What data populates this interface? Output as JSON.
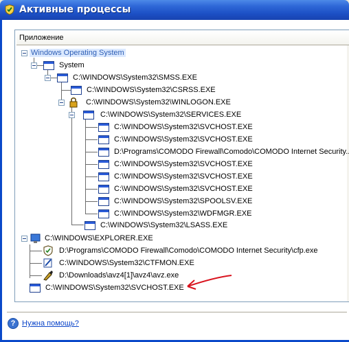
{
  "window": {
    "title": "Активные процессы"
  },
  "header": {
    "column": "Приложение"
  },
  "tree": {
    "root": "Windows Operating System",
    "system": "System",
    "smss": "C:\\WINDOWS\\System32\\SMSS.EXE",
    "csrss": "C:\\WINDOWS\\System32\\CSRSS.EXE",
    "winlogon": "C:\\WINDOWS\\System32\\WINLOGON.EXE",
    "services": "C:\\WINDOWS\\System32\\SERVICES.EXE",
    "svchost1": "C:\\WINDOWS\\System32\\SVCHOST.EXE",
    "svchost2": "C:\\WINDOWS\\System32\\SVCHOST.EXE",
    "comodo_security": "D:\\Programs\\COMODO Firewall\\Comodo\\COMODO Internet Security...",
    "svchost3": "C:\\WINDOWS\\System32\\SVCHOST.EXE",
    "svchost4": "C:\\WINDOWS\\System32\\SVCHOST.EXE",
    "svchost5": "C:\\WINDOWS\\System32\\SVCHOST.EXE",
    "spoolsv": "C:\\WINDOWS\\System32\\SPOOLSV.EXE",
    "wdfmgr": "C:\\WINDOWS\\System32\\WDFMGR.EXE",
    "lsass": "C:\\WINDOWS\\System32\\LSASS.EXE",
    "explorer": "C:\\WINDOWS\\EXPLORER.EXE",
    "cfp": "D:\\Programs\\COMODO Firewall\\Comodo\\COMODO Internet Security\\cfp.exe",
    "ctfmon": "C:\\WINDOWS\\System32\\CTFMON.EXE",
    "avz": "D:\\Downloads\\avz4[1]\\avz4\\avz.exe",
    "svchost_orphan": "C:\\WINDOWS\\System32\\SVCHOST.EXE"
  },
  "footer": {
    "help_label": "Нужна помощь?"
  },
  "colors": {
    "titlebar": "#1c4fc4",
    "selection_text": "#2f5fb5",
    "link": "#0a44c9",
    "annotation_arrow": "#d9131e"
  }
}
